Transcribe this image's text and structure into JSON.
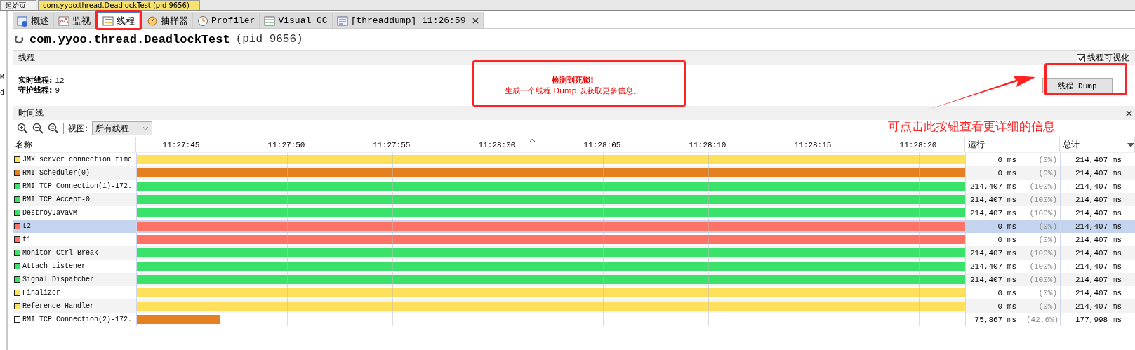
{
  "document_tabs": [
    {
      "label": "起始页",
      "selected": false
    },
    {
      "label": "com.yyoo.thread.DeadlockTest (pid 9656)",
      "selected": true
    }
  ],
  "sidebar": {
    "fragments": [
      "M",
      "d"
    ]
  },
  "tool_tabs": [
    {
      "label": "概述",
      "kind": "overview",
      "selected": false
    },
    {
      "label": "监视",
      "kind": "monitor",
      "selected": false
    },
    {
      "label": "线程",
      "kind": "threads",
      "selected": true
    },
    {
      "label": "抽样器",
      "kind": "sampler",
      "selected": false
    },
    {
      "label": "Profiler",
      "kind": "profiler",
      "selected": false
    },
    {
      "label": "Visual GC",
      "kind": "visualgc",
      "selected": false
    },
    {
      "label": "[threaddump] 11:26:59",
      "kind": "threaddump",
      "selected": false,
      "closable": true
    }
  ],
  "app": {
    "title": "com.yyoo.thread.DeadlockTest",
    "pid": "(pid 9656)"
  },
  "threads_section": {
    "title": "线程",
    "visualize": {
      "label": "线程可视化",
      "checked": true
    },
    "stats": [
      {
        "label": "实时线程:",
        "value": "12"
      },
      {
        "label": "守护线程:",
        "value": "9"
      }
    ],
    "alert": {
      "title": "检测到死锁!",
      "message": "生成一个线程 Dump 以获取更多信息。"
    },
    "dump_button": "线程 Dump"
  },
  "timeline": {
    "title": "时间线",
    "view_label": "视图:",
    "view_value": "所有线程",
    "columns": [
      "名称",
      "运行",
      "总计"
    ],
    "ticks": [
      "11:27:45",
      "11:27:50",
      "11:27:55",
      "11:28:00",
      "11:28:05",
      "11:28:10",
      "11:28:15",
      "11:28:20"
    ],
    "rows": [
      {
        "name": "JMX server connection time",
        "color": "#ffe05a",
        "bar": {
          "color": "#ffe05a",
          "level": 1
        },
        "run": "0 ms",
        "percent": "(0%)",
        "total": "214,407 ms",
        "selected": false
      },
      {
        "name": "RMI Scheduler(0)",
        "color": "#e58020",
        "bar": {
          "color": "#e58020",
          "level": 1
        },
        "run": "0 ms",
        "percent": "(0%)",
        "total": "214,407 ms",
        "selected": false
      },
      {
        "name": "RMI TCP Connection(1)-172.",
        "color": "#3ae26a",
        "bar": {
          "color": "#3ae26a",
          "level": 1
        },
        "run": "214,407 ms",
        "percent": "(100%)",
        "total": "214,407 ms",
        "selected": false
      },
      {
        "name": "RMI TCP Accept-0",
        "color": "#3ae26a",
        "bar": {
          "color": "#3ae26a",
          "level": 1
        },
        "run": "214,407 ms",
        "percent": "(100%)",
        "total": "214,407 ms",
        "selected": false
      },
      {
        "name": "DestroyJavaVM",
        "color": "#3ae26a",
        "bar": {
          "color": "#3ae26a",
          "level": 1
        },
        "run": "214,407 ms",
        "percent": "(100%)",
        "total": "214,407 ms",
        "selected": false
      },
      {
        "name": "t2",
        "color": "#ff7367",
        "bar": {
          "color": "#ff7367",
          "level": 1
        },
        "run": "0 ms",
        "percent": "(0%)",
        "total": "214,407 ms",
        "selected": true
      },
      {
        "name": "t1",
        "color": "#ff7367",
        "bar": {
          "color": "#ff7367",
          "level": 1
        },
        "run": "0 ms",
        "percent": "(0%)",
        "total": "214,407 ms",
        "selected": false
      },
      {
        "name": "Monitor Ctrl-Break",
        "color": "#3ae26a",
        "bar": {
          "color": "#3ae26a",
          "level": 1
        },
        "run": "214,407 ms",
        "percent": "(100%)",
        "total": "214,407 ms",
        "selected": false
      },
      {
        "name": "Attach Listener",
        "color": "#3ae26a",
        "bar": {
          "color": "#3ae26a",
          "level": 1
        },
        "run": "214,407 ms",
        "percent": "(100%)",
        "total": "214,407 ms",
        "selected": false
      },
      {
        "name": "Signal Dispatcher",
        "color": "#3ae26a",
        "bar": {
          "color": "#3ae26a",
          "level": 1
        },
        "run": "214,407 ms",
        "percent": "(100%)",
        "total": "214,407 ms",
        "selected": false
      },
      {
        "name": "Finalizer",
        "color": "#ffe05a",
        "bar": {
          "color": "#ffe05a",
          "level": 1
        },
        "run": "0 ms",
        "percent": "(0%)",
        "total": "214,407 ms",
        "selected": false
      },
      {
        "name": "Reference Handler",
        "color": "#ffe05a",
        "bar": {
          "color": "#ffe05a",
          "level": 1
        },
        "run": "0 ms",
        "percent": "(0%)",
        "total": "214,407 ms",
        "selected": false
      },
      {
        "name": "RMI TCP Connection(2)-172.",
        "color": "#ffffff",
        "bar": {
          "color": "#e58020",
          "level": 0.1
        },
        "run": "75,867 ms",
        "percent": "(42.6%)",
        "total": "177,998 ms",
        "selected": false
      }
    ]
  },
  "annotation": {
    "text": "可点击此按钮查看更详细的信息"
  }
}
